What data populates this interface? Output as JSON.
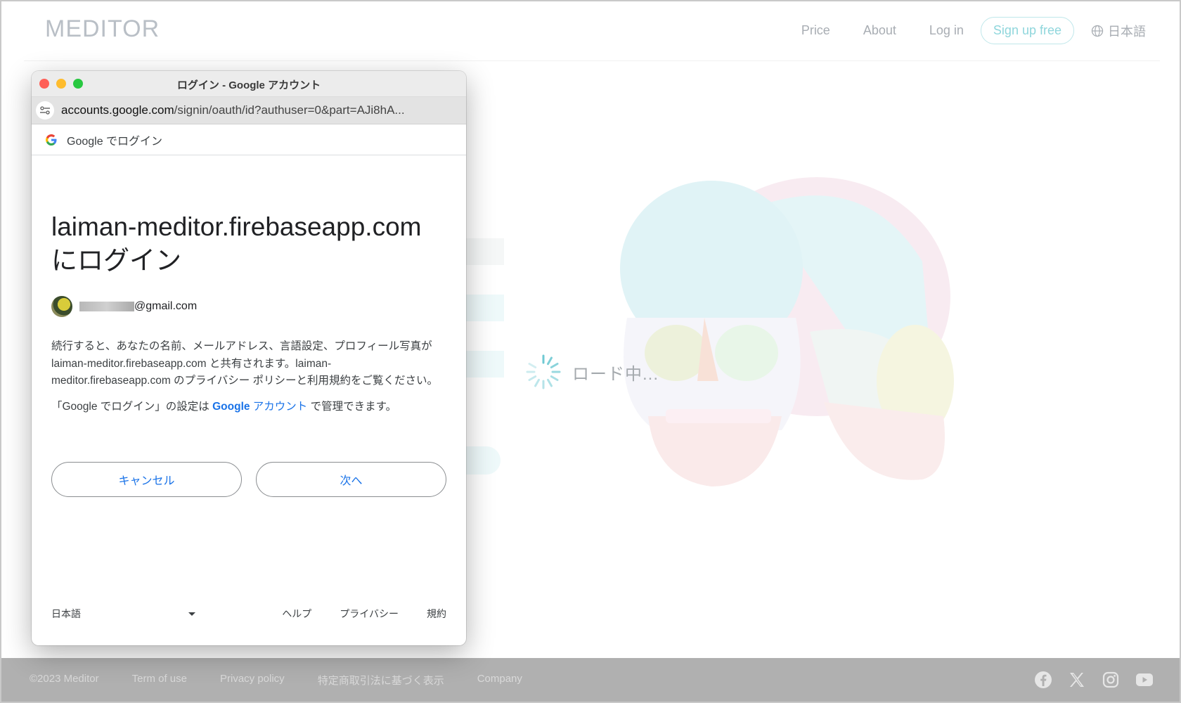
{
  "site": {
    "logo": "MEDITOR",
    "nav": {
      "price": "Price",
      "about": "About",
      "login": "Log in",
      "signup": "Sign up free",
      "language": "日本語"
    },
    "loading_text": "ロード中...",
    "footer": {
      "copyright": "©2023 Meditor",
      "terms": "Term of use",
      "privacy": "Privacy policy",
      "commerce": "特定商取引法に基づく表示",
      "company": "Company",
      "social": [
        "facebook-icon",
        "x-icon",
        "instagram-icon",
        "youtube-icon"
      ]
    }
  },
  "popup": {
    "window_title": "ログイン - Google アカウント",
    "url_domain": "accounts.google.com",
    "url_path": "/signin/oauth/id?authuser=0&part=AJi8hA...",
    "google_bar_text": "Google でログイン",
    "heading": "laiman-meditor.firebaseapp.com にログイン",
    "email_suffix": "@gmail.com",
    "description": "続行すると、あなたの名前、メールアドレス、言語設定、プロフィール写真が laiman-meditor.firebaseapp.com と共有されます。laiman-meditor.firebaseapp.com のプライバシー ポリシーと利用規約をご覧ください。",
    "manage_prefix": "「Google でログイン」の設定は ",
    "manage_link_google": "Google",
    "manage_link_account": " アカウント",
    "manage_suffix": " で管理できます。",
    "cancel_label": "キャンセル",
    "next_label": "次へ",
    "footer": {
      "language": "日本語",
      "help": "ヘルプ",
      "privacy": "プライバシー",
      "terms": "規約"
    }
  },
  "colors": {
    "accent_cyan": "#8fd6dc",
    "google_blue": "#1a73e8",
    "footer_bg": "#b0b0b0"
  }
}
